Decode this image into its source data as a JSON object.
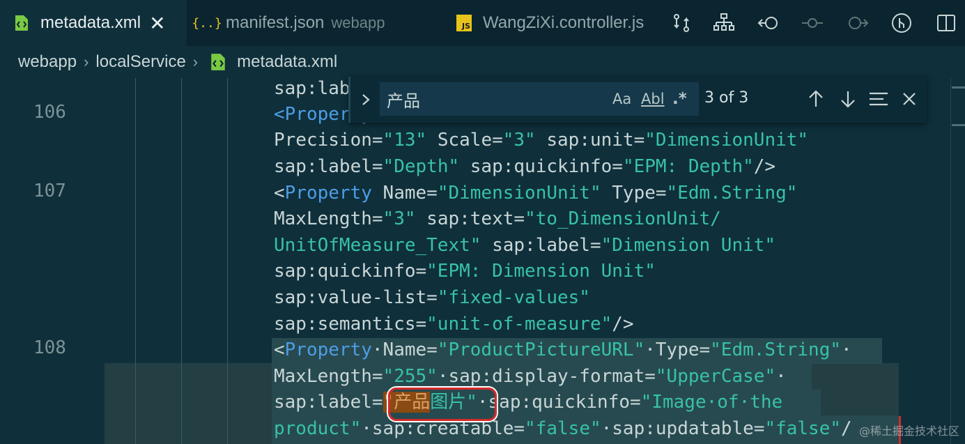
{
  "tabs": [
    {
      "label": "metadata.xml",
      "icon": "xml-file-icon",
      "active": true,
      "close": "✕"
    },
    {
      "label": "manifest.json",
      "description": "webapp",
      "icon": "json-file-icon",
      "icon_text": "{..}"
    },
    {
      "label": "WangZiXi.controller.js",
      "icon": "js-file-icon",
      "icon_text": "JS"
    }
  ],
  "editor_actions": [
    "compare-changes-icon",
    "structure-icon",
    "go-back-icon",
    "timeline-icon",
    "go-forward-icon",
    "git-lens-icon",
    "split-editor-icon"
  ],
  "breadcrumb": [
    "webapp",
    "localService",
    "metadata.xml"
  ],
  "find": {
    "query": "产品",
    "match_case": "Aa",
    "whole_word": "Abl",
    "regex": ".*",
    "count": "3 of 3"
  },
  "code": {
    "line_numbers": [
      "106",
      "107",
      "108"
    ],
    "l0": "sap:lab",
    "l1_tag": "<Property",
    "l2a": "Precision=",
    "l2b": "\"13\"",
    "l2c": " Scale=",
    "l2d": "\"3\"",
    "l2e": " sap:unit=",
    "l2f": "\"DimensionUnit\"",
    "l3a": "sap:label=",
    "l3b": "\"Depth\"",
    "l3c": " sap:quickinfo=",
    "l3d": "\"EPM: Depth\"",
    "l3e": "/>",
    "l4a": "<",
    "l4b": "Property",
    "l4c": " Name=",
    "l4d": "\"DimensionUnit\"",
    "l4e": " Type=",
    "l4f": "\"Edm.String\"",
    "l5a": "MaxLength=",
    "l5b": "\"3\"",
    "l5c": " sap:text=",
    "l5d": "\"to_DimensionUnit/",
    "l6a": "UnitOfMeasure_Text\"",
    "l6b": " sap:label=",
    "l6c": "\"Dimension Unit\"",
    "l7a": "sap:quickinfo=",
    "l7b": "\"EPM: Dimension Unit\"",
    "l8a": "sap:value-list=",
    "l8b": "\"fixed-values\"",
    "l9a": "sap:semantics=",
    "l9b": "\"unit-of-measure\"",
    "l9c": "/>",
    "l10a": "<",
    "l10b": "Property",
    "l10c": "·Name=",
    "l10d": "\"ProductPictureURL\"",
    "l10e": "·Type=",
    "l10f": "\"Edm.String\"",
    "l10g": "·",
    "l11a": "MaxLength=",
    "l11b": "\"255\"",
    "l11c": "·sap:display-format=",
    "l11d": "\"UpperCase\"",
    "l11e": "·",
    "l12a": "sap:label=",
    "l12b": "\"",
    "l12c": "产品",
    "l12d": "图片\"",
    "l12e": "·sap:quickinfo=",
    "l12f": "\"Image·of·the",
    "l13a": "product\"",
    "l13b": "·sap:creatable=",
    "l13c": "\"false\"",
    "l13d": "·sap:updatable=",
    "l13e": "\"false\"",
    "l13f": "/"
  },
  "watermark": "@稀土掘金技术社区"
}
